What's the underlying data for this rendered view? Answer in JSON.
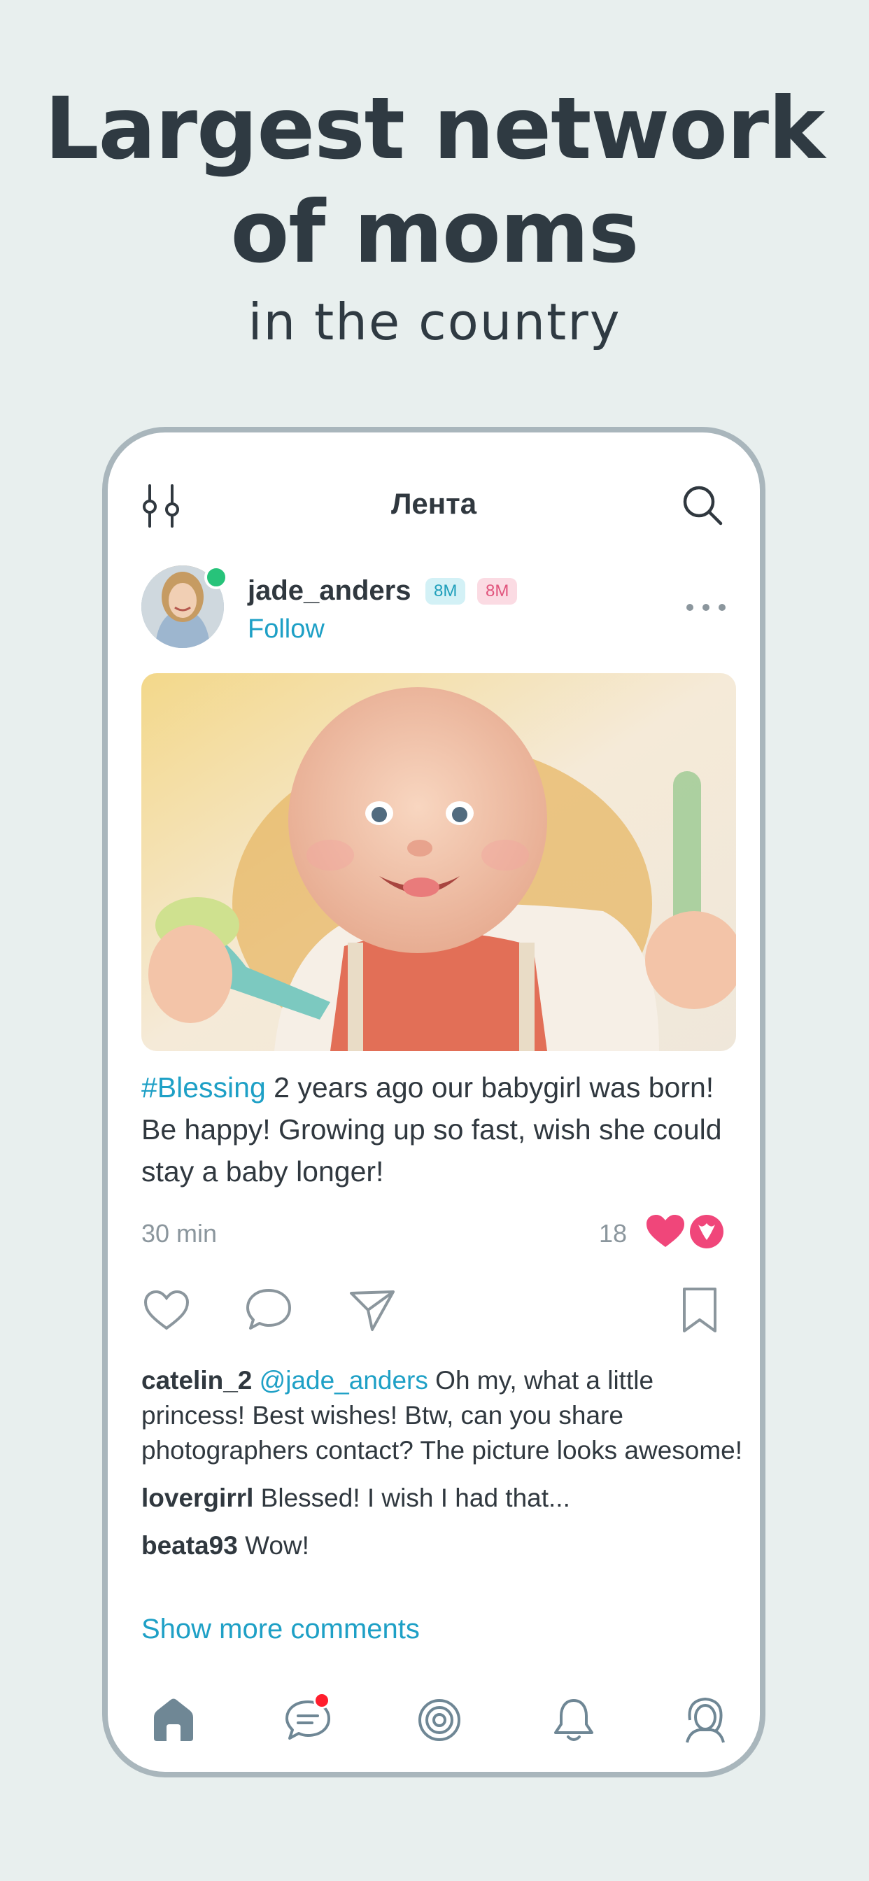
{
  "promo": {
    "headline_line1": "Largest network",
    "headline_line2": "of moms",
    "subhead": "in the country"
  },
  "topbar": {
    "title": "Лента",
    "left_icon": "filter-sliders-icon",
    "right_icon": "search-icon"
  },
  "post": {
    "username": "jade_anders",
    "badges": [
      "8M",
      "8M"
    ],
    "follow_label": "Follow",
    "hashtag": "#Blessing",
    "text": " 2 years ago our babygirl was born! Be happy! Growing up so fast, wish she could stay a baby longer!",
    "time": "30 min",
    "likes": "18",
    "reactions": [
      "heart-icon",
      "tulip-icon"
    ]
  },
  "comments": [
    {
      "user": "catelin_2",
      "mention": "@jade_anders",
      "text": " Oh my, what a little princess! Best wishes! Btw, can you share photographers contact? The picture looks awesome!"
    },
    {
      "user": "lovergirrl",
      "mention": "",
      "text": " Blessed! I wish I had that..."
    },
    {
      "user": "beata93",
      "mention": "",
      "text": " Wow!"
    }
  ],
  "show_more_label": "Show more comments",
  "nav": {
    "items": [
      "home-icon",
      "chat-icon",
      "target-icon",
      "bell-icon",
      "profile-icon"
    ],
    "active": "home-icon",
    "chat_has_unread": true
  },
  "colors": {
    "accent": "#1ea0c6",
    "text": "#30383f",
    "muted": "#8b969d",
    "background": "#e8efee",
    "like_pink": "#f0467a",
    "online_green": "#27c37a"
  }
}
